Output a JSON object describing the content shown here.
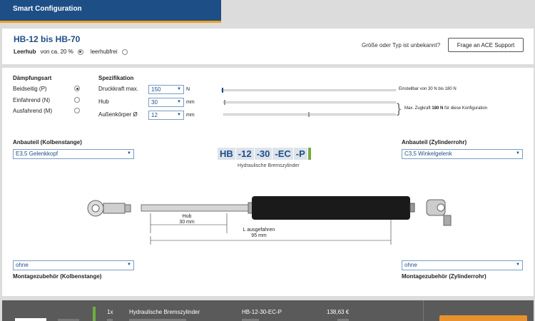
{
  "banner": {
    "title": "Smart Configuration"
  },
  "header": {
    "title": "HB-12 bis HB-70",
    "leerhub_label": "Leerhub",
    "leerhub_option": "von ca. 20 %",
    "leerhubfrei_option": "leerhubfrei",
    "unknown_text": "Größe oder Typ ist unbekannt?",
    "support_button": "Frage an ACE Support"
  },
  "daempfung": {
    "heading": "Dämpfungsart",
    "options": [
      "Beidseitig (P)",
      "Einfahrend (N)",
      "Ausfahrend (M)"
    ],
    "selected": 0
  },
  "spezifikation": {
    "heading": "Spezifikation",
    "druckkraft": {
      "label": "Druckkraft max.",
      "value": "150",
      "unit": "N",
      "hint": "Einstellbar von 30 N bis 180 N"
    },
    "hub": {
      "label": "Hub",
      "value": "30",
      "unit": "mm"
    },
    "aussen": {
      "label": "Außenkörper Ø",
      "value": "12",
      "unit": "mm"
    },
    "zugkraft_prefix": "Max. Zugkraft",
    "zugkraft_value": "180 N",
    "zugkraft_suffix": "für diese Konfiguration"
  },
  "anbauteil_links": {
    "label": "Anbauteil (Kolbenstange)",
    "value": "E3,5 Gelenkkopf"
  },
  "anbauteil_rechts": {
    "label": "Anbauteil (Zylinderrohr)",
    "value": "C3,5 Winkelgelenk"
  },
  "code": {
    "segments": [
      "HB",
      "-12",
      "-30",
      "-EC",
      "-P"
    ],
    "subtitle": "Hydraulische Bremszylinder"
  },
  "drawing": {
    "hub_label": "Hub",
    "hub_value": "30 mm",
    "l_label": "L ausgefahren",
    "l_value": "95 mm"
  },
  "montage_links": {
    "value": "ohne",
    "label": "Montagezubehör (Kolbenstange)"
  },
  "montage_rechts": {
    "value": "ohne",
    "label": "Montagezubehör (Zylinderrohr)"
  },
  "cart": {
    "qty": "1x",
    "name": "Hydraulische Bremszylinder",
    "code": "HB-12-30-EC-P",
    "price": "138,63 €"
  },
  "colors": {
    "brand_blue": "#1d4f86",
    "accent_orange": "#f0a020",
    "green": "#6fae3e"
  }
}
